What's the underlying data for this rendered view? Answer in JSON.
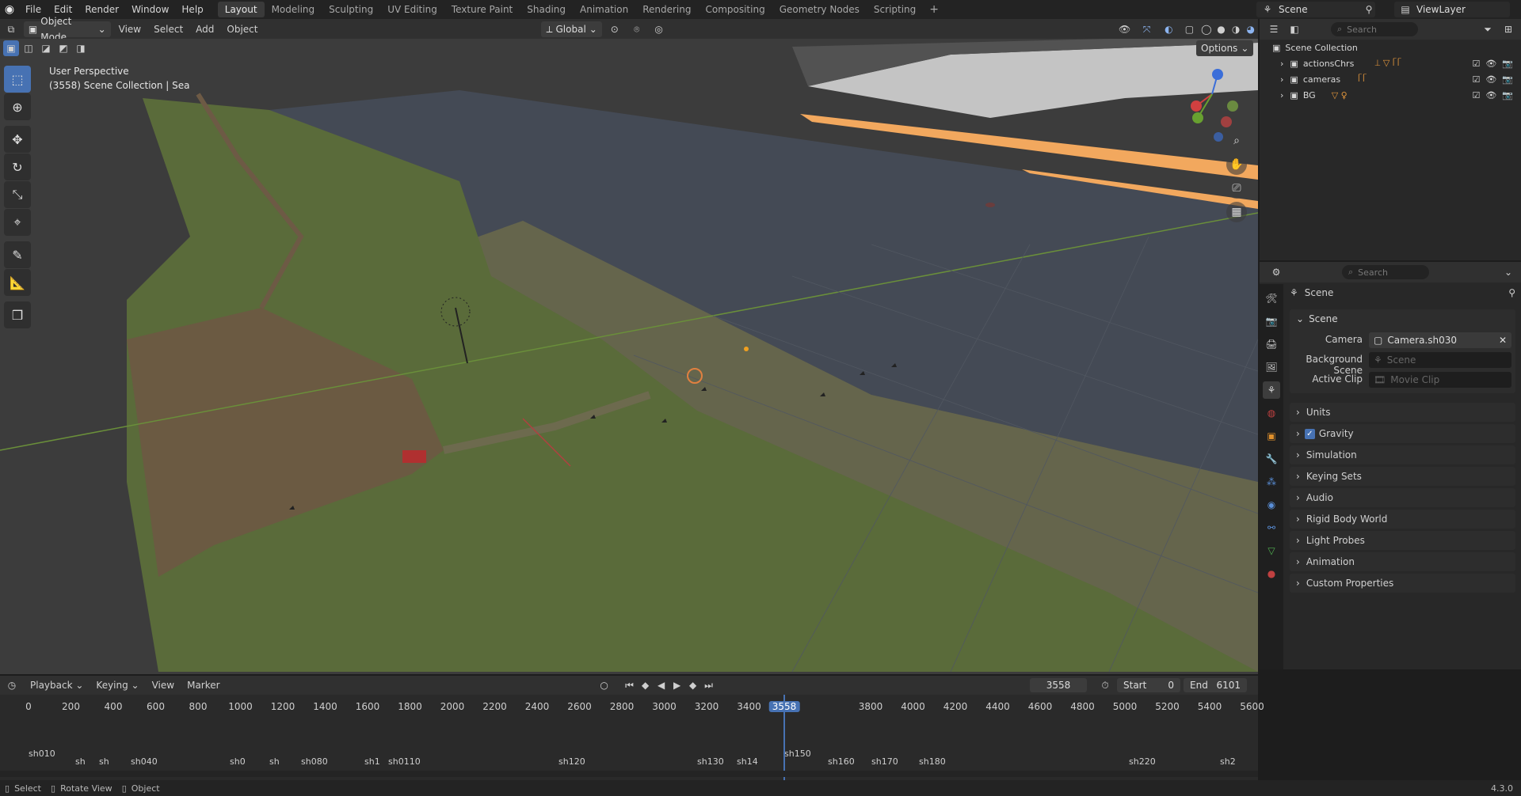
{
  "menu": {
    "items": [
      "File",
      "Edit",
      "Render",
      "Window",
      "Help"
    ]
  },
  "workspaces": [
    "Layout",
    "Modeling",
    "Sculpting",
    "UV Editing",
    "Texture Paint",
    "Shading",
    "Animation",
    "Rendering",
    "Compositing",
    "Geometry Nodes",
    "Scripting"
  ],
  "active_workspace": "Layout",
  "scene_name": "Scene",
  "view_layer": "ViewLayer",
  "viewport_header": {
    "mode": "Object Mode",
    "menus": [
      "View",
      "Select",
      "Add",
      "Object"
    ],
    "transform": "Global",
    "options": "Options"
  },
  "viewport": {
    "perspective": "User Perspective",
    "collection_info": "(3558) Scene Collection | Sea"
  },
  "outliner": {
    "search_placeholder": "Search",
    "root": "Scene Collection",
    "items": [
      {
        "name": "actionsChrs"
      },
      {
        "name": "cameras"
      },
      {
        "name": "BG"
      }
    ]
  },
  "properties": {
    "search_placeholder": "Search",
    "context": "Scene",
    "panel_title": "Scene",
    "camera_label": "Camera",
    "camera_value": "Camera.sh030",
    "bg_scene_label": "Background Scene",
    "bg_scene_placeholder": "Scene",
    "active_clip_label": "Active Clip",
    "active_clip_placeholder": "Movie Clip",
    "subpanels": [
      "Units",
      "Gravity",
      "Simulation",
      "Keying Sets",
      "Audio",
      "Rigid Body World",
      "Light Probes",
      "Animation",
      "Custom Properties"
    ],
    "gravity_checked": true
  },
  "timeline": {
    "menus": [
      "Playback",
      "Keying",
      "View",
      "Marker"
    ],
    "current_frame": "3558",
    "start_label": "Start",
    "start_value": "0",
    "end_label": "End",
    "end_value": "6101",
    "ticks": [
      "0",
      "200",
      "400",
      "600",
      "800",
      "1000",
      "1200",
      "1400",
      "1600",
      "1800",
      "2000",
      "2200",
      "2400",
      "2600",
      "2800",
      "3000",
      "3200",
      "3400",
      "3558",
      "3800",
      "4000",
      "4200",
      "4400",
      "4600",
      "4800",
      "5000",
      "5200",
      "5400",
      "5600"
    ],
    "markers": [
      "sh010",
      "sh",
      "sh",
      "sh040",
      "sh0",
      "sh",
      "sh080",
      "sh1",
      "sh0110",
      "sh120",
      "sh130",
      "sh14",
      "sh150",
      "sh160",
      "sh170",
      "sh180",
      "sh220",
      "sh2"
    ]
  },
  "statusbar": {
    "items": [
      "Select",
      "Rotate View",
      "Object"
    ],
    "version": "4.3.0"
  },
  "colors": {
    "accent": "#4772b3",
    "frame_indicator": "#4772b3"
  }
}
